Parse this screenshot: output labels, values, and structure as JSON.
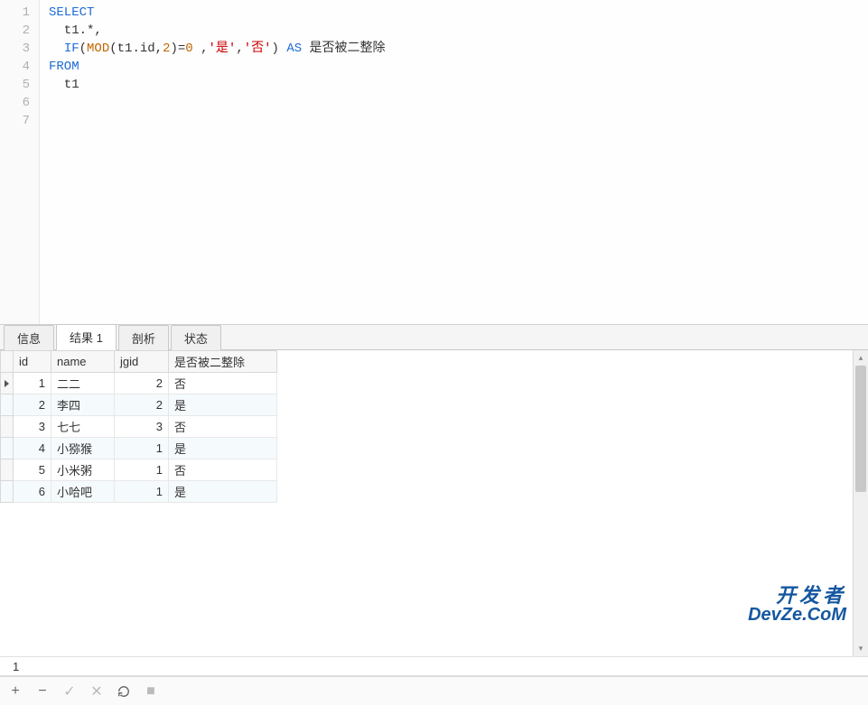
{
  "editor": {
    "lines": [
      {
        "n": 1,
        "tokens": [
          {
            "t": "SELECT",
            "c": "kw"
          }
        ]
      },
      {
        "n": 2,
        "tokens": [
          {
            "t": "  t1.*,",
            "c": ""
          }
        ]
      },
      {
        "n": 3,
        "tokens": [
          {
            "t": "  ",
            "c": ""
          },
          {
            "t": "IF",
            "c": "kw"
          },
          {
            "t": "(",
            "c": "op"
          },
          {
            "t": "MOD",
            "c": "fn"
          },
          {
            "t": "(t1.id,",
            "c": ""
          },
          {
            "t": "2",
            "c": "num"
          },
          {
            "t": ")",
            "c": ""
          },
          {
            "t": "=",
            "c": "op"
          },
          {
            "t": "0",
            "c": "num"
          },
          {
            "t": " ,",
            "c": ""
          },
          {
            "t": "'是'",
            "c": "str"
          },
          {
            "t": ",",
            "c": ""
          },
          {
            "t": "'否'",
            "c": "str"
          },
          {
            "t": ") ",
            "c": ""
          },
          {
            "t": "AS",
            "c": "kw"
          },
          {
            "t": " 是否被二整除",
            "c": ""
          }
        ]
      },
      {
        "n": 4,
        "tokens": [
          {
            "t": "FROM",
            "c": "kw"
          }
        ]
      },
      {
        "n": 5,
        "tokens": [
          {
            "t": "  t1",
            "c": ""
          }
        ]
      },
      {
        "n": 6,
        "tokens": []
      },
      {
        "n": 7,
        "tokens": []
      }
    ]
  },
  "tabs": [
    {
      "label": "信息",
      "active": false
    },
    {
      "label": "结果 1",
      "active": true
    },
    {
      "label": "剖析",
      "active": false
    },
    {
      "label": "状态",
      "active": false
    }
  ],
  "results": {
    "columns": [
      "id",
      "name",
      "jgid",
      "是否被二整除"
    ],
    "rows": [
      {
        "id": 1,
        "name": "二二",
        "jgid": 2,
        "divide": "否",
        "current": true
      },
      {
        "id": 2,
        "name": "李四",
        "jgid": 2,
        "divide": "是",
        "current": false
      },
      {
        "id": 3,
        "name": "七七",
        "jgid": 3,
        "divide": "否",
        "current": false
      },
      {
        "id": 4,
        "name": "小猕猴",
        "jgid": 1,
        "divide": "是",
        "current": false
      },
      {
        "id": 5,
        "name": "小米粥",
        "jgid": 1,
        "divide": "否",
        "current": false
      },
      {
        "id": 6,
        "name": "小哈吧",
        "jgid": 1,
        "divide": "是",
        "current": false
      }
    ]
  },
  "status": {
    "text": "1"
  },
  "watermark": {
    "line1": "开发者",
    "line2": "DevZe.CoM"
  },
  "toolbar": {
    "add": "+",
    "remove": "−",
    "apply": "✓",
    "cancel": "✕",
    "refresh": "C",
    "stop": "■"
  },
  "chart_data": {
    "type": "table",
    "columns": [
      "id",
      "name",
      "jgid",
      "是否被二整除"
    ],
    "rows": [
      [
        1,
        "二二",
        2,
        "否"
      ],
      [
        2,
        "李四",
        2,
        "是"
      ],
      [
        3,
        "七七",
        3,
        "否"
      ],
      [
        4,
        "小猕猴",
        1,
        "是"
      ],
      [
        5,
        "小米粥",
        1,
        "否"
      ],
      [
        6,
        "小哈吧",
        1,
        "是"
      ]
    ]
  }
}
